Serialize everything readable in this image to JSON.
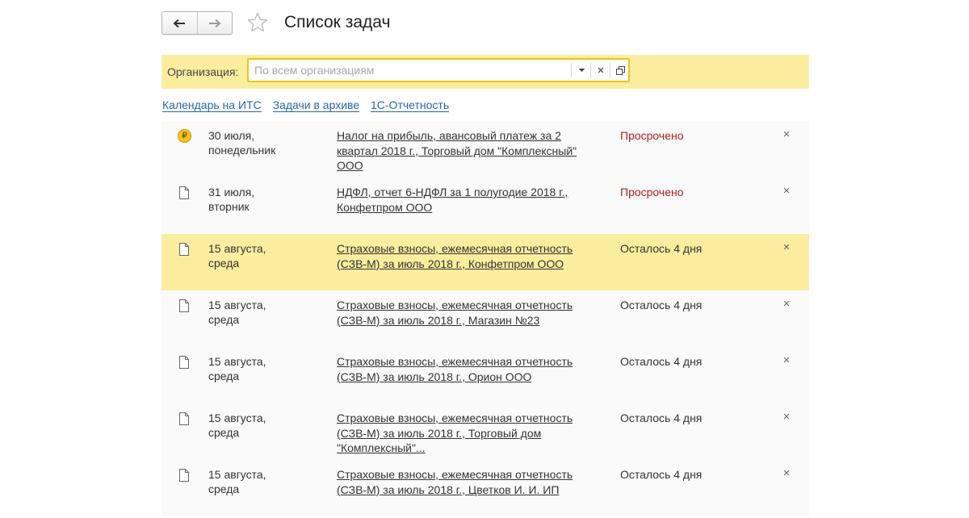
{
  "header": {
    "title": "Список задач",
    "back_icon": "arrow-left-icon",
    "forward_icon": "arrow-right-icon",
    "favorite_icon": "star-icon"
  },
  "filter": {
    "label": "Организация:",
    "placeholder": "По всем организациям",
    "value": ""
  },
  "links": [
    "Календарь на ИТС",
    "Задачи в архиве",
    "1С-Отчетность"
  ],
  "tasks": [
    {
      "icon": "ruble-coin-icon",
      "date": "30 июля, понедельник",
      "text": "Налог на прибыль, авансовый платеж за 2 квартал 2018 г., Торговый дом \"Комплексный\" ООО",
      "status": "Просрочено",
      "overdue": true,
      "selected": false
    },
    {
      "icon": "document-icon",
      "date": "31 июля, вторник",
      "text": "НДФЛ, отчет 6-НДФЛ за 1 полугодие 2018 г., Конфетпром ООО",
      "status": "Просрочено",
      "overdue": true,
      "selected": false
    },
    {
      "icon": "document-icon",
      "date": "15 августа, среда",
      "text": "Страховые взносы, ежемесячная отчетность (СЗВ-М) за июль 2018 г., Конфетпром ООО",
      "status": "Осталось 4 дня",
      "overdue": false,
      "selected": true
    },
    {
      "icon": "document-icon",
      "date": "15 августа, среда",
      "text": "Страховые взносы, ежемесячная отчетность (СЗВ-М) за июль 2018 г., Магазин №23",
      "status": "Осталось 4 дня",
      "overdue": false,
      "selected": false
    },
    {
      "icon": "document-icon",
      "date": "15 августа, среда",
      "text": "Страховые взносы, ежемесячная отчетность (СЗВ-М) за июль 2018 г., Орион ООО",
      "status": "Осталось 4 дня",
      "overdue": false,
      "selected": false
    },
    {
      "icon": "document-icon",
      "date": "15 августа, среда",
      "text": "Страховые взносы, ежемесячная отчетность (СЗВ-М) за июль 2018 г., Торговый дом \"Комплексный\"...",
      "status": "Осталось 4 дня",
      "overdue": false,
      "selected": false
    },
    {
      "icon": "document-icon",
      "date": "15 августа, среда",
      "text": "Страховые взносы, ежемесячная отчетность (СЗВ-М) за июль 2018 г., Цветков И. И. ИП",
      "status": "Осталось 4 дня",
      "overdue": false,
      "selected": false
    }
  ],
  "colors": {
    "selected_row": "#fbed9e",
    "overdue": "#b51d1d",
    "link": "#2466b1",
    "field_border": "#f0c419"
  }
}
